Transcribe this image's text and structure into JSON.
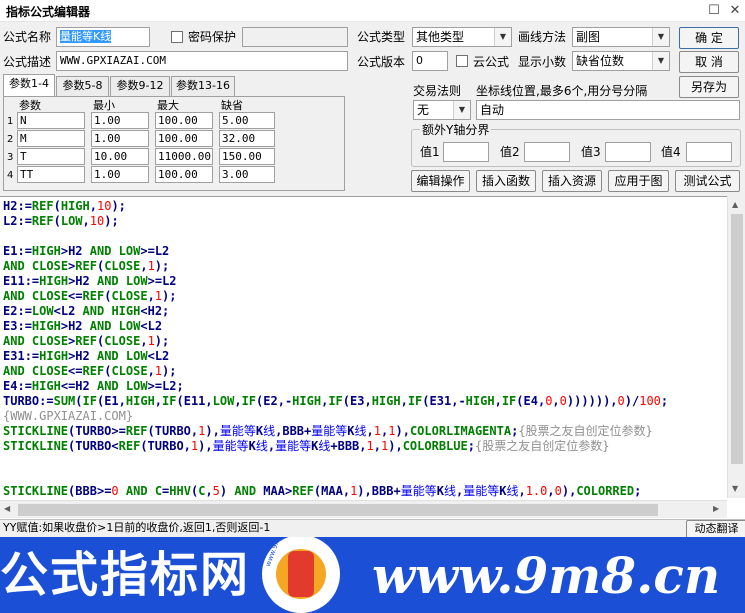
{
  "window": {
    "title": "指标公式编辑器",
    "restore_symbol": "☐",
    "close_symbol": "✕"
  },
  "form": {
    "name_label": "公式名称",
    "name_value": "量能等K线",
    "password_label": "密码保护",
    "desc_label": "公式描述",
    "desc_value": "WWW.GPXIAZAI.COM",
    "type_label": "公式类型",
    "type_value": "其他类型",
    "draw_label": "画线方法",
    "draw_value": "副图",
    "version_label": "公式版本",
    "version_value": "0",
    "cloud_label": "云公式",
    "decimal_label": "显示小数",
    "decimal_value": "缺省位数",
    "trade_label": "交易法则",
    "trade_value": "无",
    "coord_label": "坐标线位置,最多6个,用分号分隔",
    "coord_value": "自动",
    "yaxis_label": "额外Y轴分界",
    "yaxis_values": [
      "值1",
      "值2",
      "值3",
      "值4"
    ]
  },
  "buttons": {
    "ok": "确  定",
    "cancel": "取  消",
    "save_as": "另存为",
    "edit_ops": "编辑操作",
    "insert_func": "插入函数",
    "insert_res": "插入资源",
    "apply_chart": "应用于图",
    "test": "测试公式",
    "dynamic_translate": "动态翻译"
  },
  "tabs": [
    "参数1-4",
    "参数5-8",
    "参数9-12",
    "参数13-16"
  ],
  "params": {
    "headers": [
      "参数",
      "最小",
      "最大",
      "缺省"
    ],
    "rows": [
      {
        "idx": "1",
        "name": "N",
        "min": "1.00",
        "max": "100.00",
        "def": "5.00"
      },
      {
        "idx": "2",
        "name": "M",
        "min": "1.00",
        "max": "100.00",
        "def": "32.00"
      },
      {
        "idx": "3",
        "name": "T",
        "min": "10.00",
        "max": "11000.00",
        "def": "150.00"
      },
      {
        "idx": "4",
        "name": "TT",
        "min": "1.00",
        "max": "100.00",
        "def": "3.00"
      }
    ]
  },
  "code_lines": [
    "H2:=REF(HIGH,10);",
    "L2:=REF(LOW,10);",
    "",
    "E1:=HIGH>H2 AND LOW>=L2",
    "AND CLOSE>REF(CLOSE,1);",
    "E11:=HIGH>H2 AND LOW>=L2",
    "AND CLOSE<=REF(CLOSE,1);",
    "E2:=LOW<L2 AND HIGH<H2;",
    "E3:=HIGH>H2 AND LOW<L2",
    "AND CLOSE>REF(CLOSE,1);",
    "E31:=HIGH>H2 AND LOW<L2",
    "AND CLOSE<=REF(CLOSE,1);",
    "E4:=HIGH<=H2 AND LOW>=L2;",
    "TURBO:=SUM(IF(E1,HIGH,IF(E11,LOW,IF(E2,-HIGH,IF(E3,HIGH,IF(E31,-HIGH,IF(E4,0,0)))))),0)/100;",
    "{WWW.GPXIAZAI.COM}",
    "STICKLINE(TURBO>=REF(TURBO,1),量能等K线,BBB+量能等K线,1,1),COLORLIMAGENTA;{股票之友自创定位参数}",
    "STICKLINE(TURBO<REF(TURBO,1),量能等K线,量能等K线+BBB,1,1),COLORBLUE;{股票之友自创定位参数}",
    "",
    "",
    "STICKLINE(BBB>=0 AND C=HHV(C,5) AND MAA>REF(MAA,1),BBB+量能等K线,量能等K线,1.0,0),COLORRED;"
  ],
  "status": {
    "text": "YY赋值:如果收盘价>1日前的收盘价,返回1,否则返回-1"
  },
  "banner": {
    "left_text": "公式指标网",
    "site_text": "www.9m8.cn",
    "logo_text": "www.9m8.cn"
  },
  "colors": {
    "keyword": "#008000",
    "number": "#ff0000",
    "plain": "#000080",
    "chinese": "#0000ff",
    "comment": "#909090",
    "banner": "#1a4fd6"
  }
}
